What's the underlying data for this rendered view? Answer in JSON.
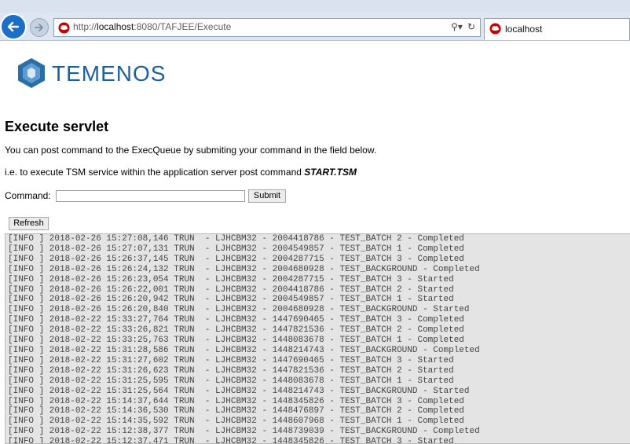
{
  "browser": {
    "url_prefix": "http://",
    "url_host": "localhost",
    "url_rest": ":8080/TAFJEE/Execute",
    "tab_title": "localhost"
  },
  "page": {
    "brand": "TEMENOS",
    "heading": "Execute servlet",
    "intro": "You can post command to the ExecQueue by submiting your command in the field below.",
    "example_prefix": "i.e. to execute TSM service within the application server post command ",
    "example_command": "START.TSM",
    "command_label": "Command:",
    "command_value": "",
    "submit_label": "Submit",
    "refresh_label": "Refresh"
  },
  "log_lines": [
    "[INFO ] 2018-02-26 15:27:08,146 TRUN  - LJHCBM32 - 2004418786 - TEST_BATCH 2 - Completed",
    "[INFO ] 2018-02-26 15:27:07,131 TRUN  - LJHCBM32 - 2004549857 - TEST_BATCH 1 - Completed",
    "[INFO ] 2018-02-26 15:26:37,145 TRUN  - LJHCBM32 - 2004287715 - TEST_BATCH 3 - Completed",
    "[INFO ] 2018-02-26 15:26:24,132 TRUN  - LJHCBM32 - 2004680928 - TEST_BACKGROUND - Completed",
    "[INFO ] 2018-02-26 15:26:23,054 TRUN  - LJHCBM32 - 2004287715 - TEST_BATCH 3 - Started",
    "[INFO ] 2018-02-26 15:26:22,001 TRUN  - LJHCBM32 - 2004418786 - TEST_BATCH 2 - Started",
    "[INFO ] 2018-02-26 15:26:20,942 TRUN  - LJHCBM32 - 2004549857 - TEST_BATCH 1 - Started",
    "[INFO ] 2018-02-26 15:26:20,840 TRUN  - LJHCBM32 - 2004680928 - TEST_BACKGROUND - Started",
    "[INFO ] 2018-02-22 15:33:27,764 TRUN  - LJHCBM32 - 1447690465 - TEST_BATCH 3 - Completed",
    "[INFO ] 2018-02-22 15:33:26,821 TRUN  - LJHCBM32 - 1447821536 - TEST_BATCH 2 - Completed",
    "[INFO ] 2018-02-22 15:33:25,763 TRUN  - LJHCBM32 - 1448083678 - TEST_BATCH 1 - Completed",
    "[INFO ] 2018-02-22 15:31:28,586 TRUN  - LJHCBM32 - 1448214743 - TEST_BACKGROUND - Completed",
    "[INFO ] 2018-02-22 15:31:27,602 TRUN  - LJHCBM32 - 1447690465 - TEST_BATCH 3 - Started",
    "[INFO ] 2018-02-22 15:31:26,623 TRUN  - LJHCBM32 - 1447821536 - TEST_BATCH 2 - Started",
    "[INFO ] 2018-02-22 15:31:25,595 TRUN  - LJHCBM32 - 1448083678 - TEST_BATCH 1 - Started",
    "[INFO ] 2018-02-22 15:31:25,564 TRUN  - LJHCBM32 - 1448214743 - TEST_BACKGROUND - Started",
    "[INFO ] 2018-02-22 15:14:37,644 TRUN  - LJHCBM32 - 1448345826 - TEST_BATCH 3 - Completed",
    "[INFO ] 2018-02-22 15:14:36,530 TRUN  - LJHCBM32 - 1448476897 - TEST_BATCH 2 - Completed",
    "[INFO ] 2018-02-22 15:14:35,592 TRUN  - LJHCBM32 - 1448607968 - TEST_BATCH 1 - Completed",
    "[INFO ] 2018-02-22 15:12:38,377 TRUN  - LJHCBM32 - 1448739039 - TEST_BACKGROUND - Completed",
    "[INFO ] 2018-02-22 15:12:37,471 TRUN  - LJHCBM32 - 1448345826 - TEST_BATCH 3 - Started"
  ],
  "icons": {
    "back": "back-arrow-icon",
    "forward": "forward-arrow-icon",
    "favicon": "redhat-favicon-icon",
    "search": "search-icon",
    "refresh": "refresh-icon",
    "logo": "temenos-logo-icon"
  },
  "colors": {
    "brand": "#1f5f9c",
    "back_button": "#1c6fc9",
    "log_background": "#e4e4e4",
    "log_text": "#444444"
  }
}
